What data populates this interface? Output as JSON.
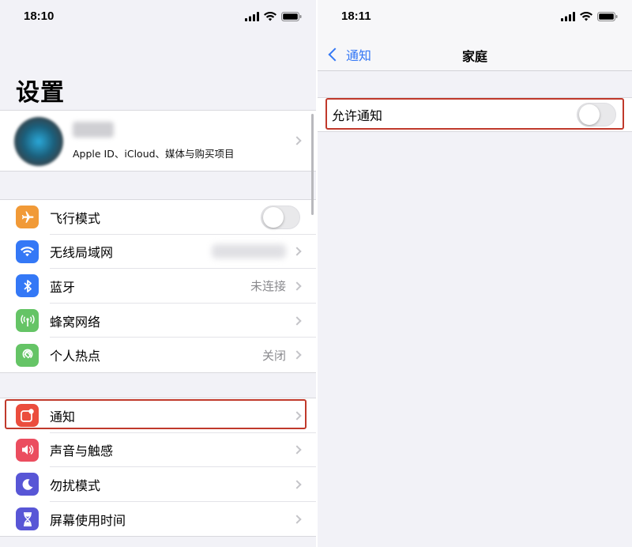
{
  "left": {
    "status_time": "18:10",
    "title": "设置",
    "profile": {
      "subtitle": "Apple ID、iCloud、媒体与购买项目"
    },
    "group1": [
      {
        "label": "飞行模式",
        "icon": "airplane-icon",
        "color": "#f19a37",
        "control": "toggle",
        "toggle_on": false
      },
      {
        "label": "无线局域网",
        "icon": "wifi-icon",
        "color": "#3478f6",
        "control": "blurred"
      },
      {
        "label": "蓝牙",
        "icon": "bluetooth-icon",
        "color": "#3478f6",
        "detail": "未连接"
      },
      {
        "label": "蜂窝网络",
        "icon": "cellular-icon",
        "color": "#65c466"
      },
      {
        "label": "个人热点",
        "icon": "hotspot-icon",
        "color": "#65c466",
        "detail": "关闭"
      }
    ],
    "group2": [
      {
        "label": "通知",
        "icon": "notifications-icon",
        "color": "#eb4d3d",
        "highlighted": true
      },
      {
        "label": "声音与触感",
        "icon": "sound-icon",
        "color": "#eb4d5f"
      },
      {
        "label": "勿扰模式",
        "icon": "moon-icon",
        "color": "#5856d6"
      },
      {
        "label": "屏幕使用时间",
        "icon": "hourglass-icon",
        "color": "#5856d6"
      }
    ]
  },
  "right": {
    "status_time": "18:11",
    "back_label": "通知",
    "nav_title": "家庭",
    "allow_label": "允许通知",
    "allow_on": false
  },
  "colors": {
    "highlight": "#c0392b",
    "link": "#3478f6"
  }
}
